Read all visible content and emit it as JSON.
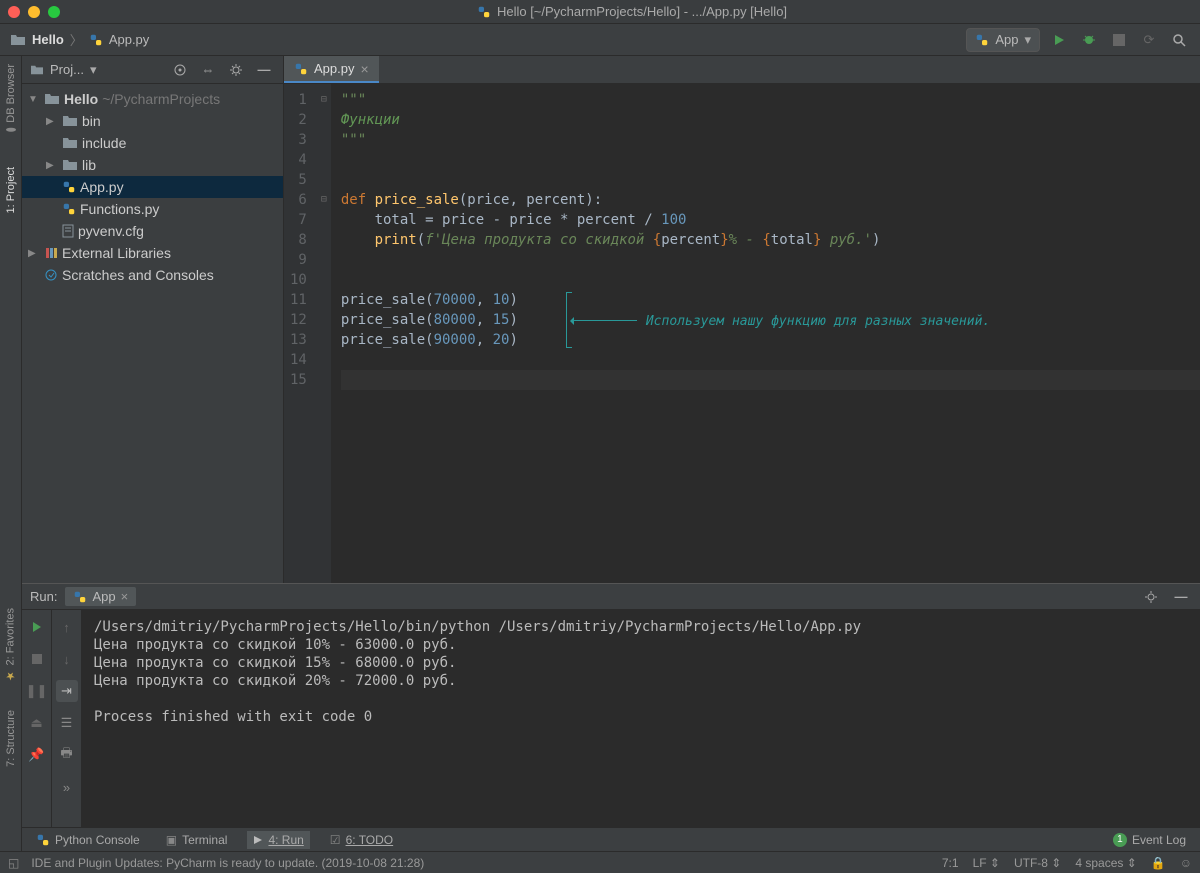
{
  "window": {
    "title": "Hello [~/PycharmProjects/Hello] - .../App.py [Hello]"
  },
  "breadcrumb": {
    "project": "Hello",
    "file": "App.py"
  },
  "toolbar": {
    "run_config": "App"
  },
  "left_gutter": {
    "db_browser": "DB Browser",
    "project": "1: Project",
    "favorites": "2: Favorites",
    "structure": "7: Structure"
  },
  "project_panel": {
    "title": "Proj...",
    "tree": {
      "root": "Hello",
      "root_path": "~/PycharmProjects",
      "items": [
        {
          "label": "bin",
          "type": "folder",
          "depth": 1,
          "arrow": "▶"
        },
        {
          "label": "include",
          "type": "folder",
          "depth": 1,
          "arrow": ""
        },
        {
          "label": "lib",
          "type": "folder",
          "depth": 1,
          "arrow": "▶"
        },
        {
          "label": "App.py",
          "type": "py",
          "depth": 1,
          "arrow": "",
          "selected": true
        },
        {
          "label": "Functions.py",
          "type": "py",
          "depth": 1,
          "arrow": ""
        },
        {
          "label": "pyvenv.cfg",
          "type": "file",
          "depth": 1,
          "arrow": ""
        }
      ],
      "external": "External Libraries",
      "scratches": "Scratches and Consoles"
    }
  },
  "editor": {
    "tab": "App.py",
    "annotation": "Используем нашу функцию для разных значений.",
    "lines": [
      {
        "n": 1,
        "fold": "⊟",
        "html": "<span class='str'>\"\"\"</span>"
      },
      {
        "n": 2,
        "fold": "",
        "html": "<span class='comment'>Функции</span>"
      },
      {
        "n": 3,
        "fold": "",
        "html": "<span class='str'>\"\"\"</span>"
      },
      {
        "n": 4,
        "fold": "",
        "html": ""
      },
      {
        "n": 5,
        "fold": "",
        "html": ""
      },
      {
        "n": 6,
        "fold": "⊟",
        "html": "<span class='kw'>def </span><span class='fn'>price_sale</span>(price, percent):"
      },
      {
        "n": 7,
        "fold": "",
        "html": "    total = price - price * percent / <span class='num'>100</span>"
      },
      {
        "n": 8,
        "fold": "",
        "html": "    <span class='fn'>print</span>(<span class='str'>f'Цена продукта со скидкой </span><span class='fstr-expr'>{</span>percent<span class='fstr-expr'>}</span><span class='str'>% - </span><span class='fstr-expr'>{</span>total<span class='fstr-expr'>}</span><span class='str'> руб.'</span>)"
      },
      {
        "n": 9,
        "fold": "",
        "html": ""
      },
      {
        "n": 10,
        "fold": "",
        "html": ""
      },
      {
        "n": 11,
        "fold": "",
        "html": "price_sale(<span class='num'>70000</span>, <span class='num'>10</span>)"
      },
      {
        "n": 12,
        "fold": "",
        "html": "price_sale(<span class='num'>80000</span>, <span class='num'>15</span>)"
      },
      {
        "n": 13,
        "fold": "",
        "html": "price_sale(<span class='num'>90000</span>, <span class='num'>20</span>)"
      },
      {
        "n": 14,
        "fold": "",
        "html": ""
      },
      {
        "n": 15,
        "fold": "",
        "html": "",
        "current": true
      }
    ]
  },
  "run": {
    "label": "Run:",
    "config": "App",
    "output": [
      "/Users/dmitriy/PycharmProjects/Hello/bin/python /Users/dmitriy/PycharmProjects/Hello/App.py",
      "Цена продукта со скидкой 10% - 63000.0 руб.",
      "Цена продукта со скидкой 15% - 68000.0 руб.",
      "Цена продукта со скидкой 20% - 72000.0 руб.",
      "",
      "Process finished with exit code 0"
    ]
  },
  "bottom_tabs": {
    "python_console": "Python Console",
    "terminal": "Terminal",
    "run": "4: Run",
    "todo": "6: TODO",
    "event_log": "Event Log"
  },
  "status": {
    "message": "IDE and Plugin Updates: PyCharm is ready to update. (2019-10-08 21:28)",
    "caret": "7:1",
    "line_sep": "LF",
    "encoding": "UTF-8",
    "indent": "4 spaces",
    "event_count": "1"
  }
}
